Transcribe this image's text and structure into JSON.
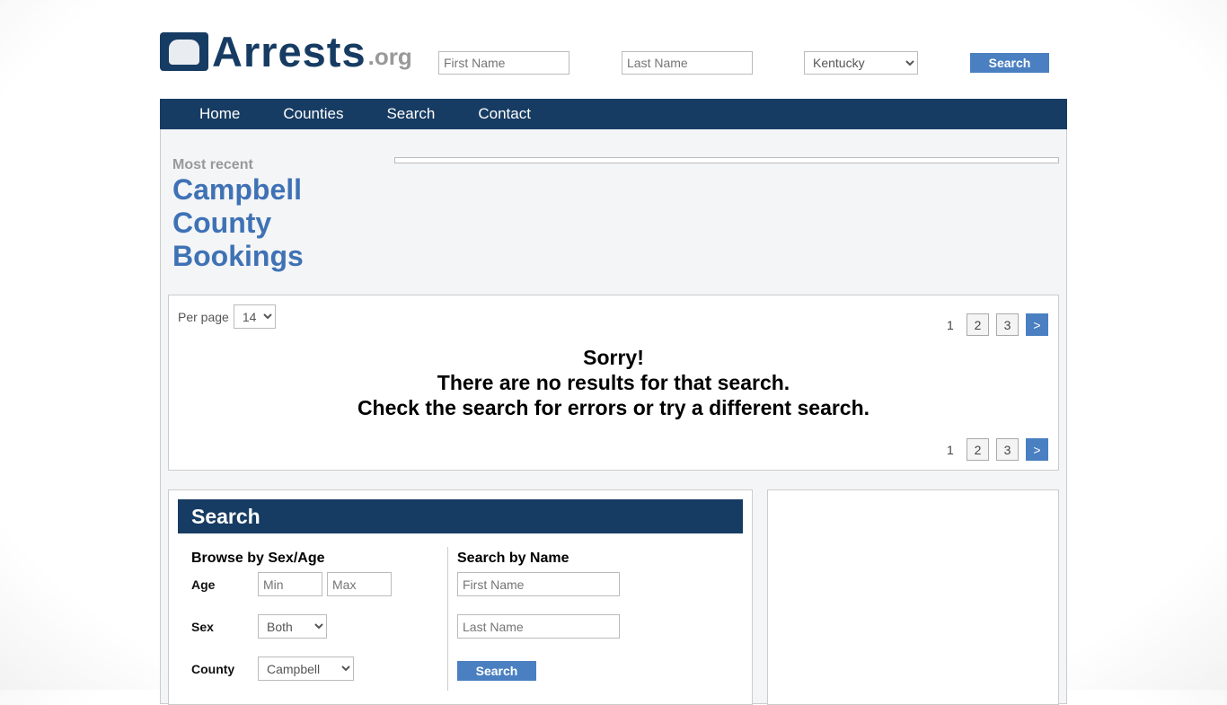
{
  "logo": {
    "text": "Arrests",
    "suffix": ".org"
  },
  "header": {
    "first_placeholder": "First Name",
    "last_placeholder": "Last Name",
    "state": "Kentucky",
    "search": "Search"
  },
  "nav": [
    "Home",
    "Counties",
    "Search",
    "Contact"
  ],
  "hero": {
    "kicker": "Most recent",
    "title1": "Campbell",
    "title2": "County",
    "title3": "Bookings"
  },
  "results": {
    "per_page_label": "Per page",
    "per_page": "14",
    "pages": [
      "1",
      "2",
      "3"
    ],
    "next": ">",
    "msg1": "Sorry!",
    "msg2": "There are no results for that search.",
    "msg3": "Check the search for errors or try a different search."
  },
  "search": {
    "title": "Search",
    "browse": "Browse by Sex/Age",
    "age": "Age",
    "min": "Min",
    "max": "Max",
    "sex": "Sex",
    "sex_val": "Both",
    "county": "County",
    "county_val": "Campbell",
    "by_name": "Search by Name",
    "first": "First Name",
    "last": "Last Name",
    "button": "Search"
  }
}
